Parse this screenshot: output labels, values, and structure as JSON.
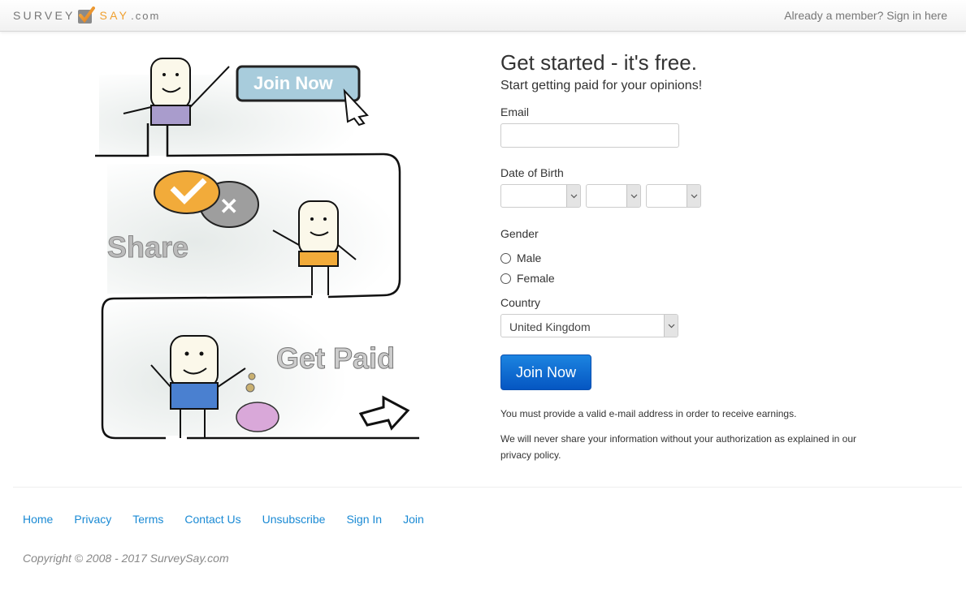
{
  "header": {
    "logo": {
      "part1": "SURVEY",
      "part2": "SAY",
      "part3": ".com"
    },
    "signin_link": "Already a member? Sign in here"
  },
  "illustration": {
    "step1_button": "Join Now",
    "step2_label": "Share",
    "step3_label": "Get Paid"
  },
  "form": {
    "title": "Get started - it's free.",
    "subtitle": "Start getting paid for your opinions!",
    "email": {
      "label": "Email",
      "value": "",
      "placeholder": ""
    },
    "dob": {
      "label": "Date of Birth",
      "day": "",
      "month": "",
      "year": ""
    },
    "gender": {
      "label": "Gender",
      "options": [
        "Male",
        "Female"
      ],
      "selected": null
    },
    "country": {
      "label": "Country",
      "selected": "United Kingdom"
    },
    "submit_label": "Join Now",
    "note1": "You must provide a valid e-mail address in order to receive earnings.",
    "note2": "We will never share your information without your authorization as explained in our privacy policy."
  },
  "footer": {
    "links": [
      "Home",
      "Privacy",
      "Terms",
      "Contact Us",
      "Unsubscribe",
      "Sign In",
      "Join"
    ],
    "copyright": "Copyright © 2008 - 2017 SurveySay.com"
  },
  "colors": {
    "accent": "#0a6ad6",
    "link": "#1a8ad4",
    "logo_orange": "#f0a030"
  }
}
